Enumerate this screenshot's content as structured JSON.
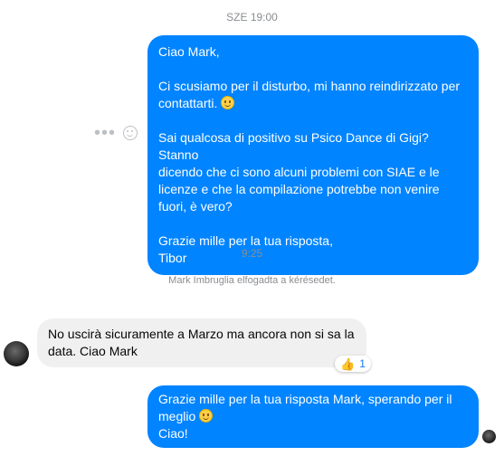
{
  "timestamps": {
    "first": "SZE 19:00",
    "second": "9:25"
  },
  "system_message": "Mark Imbruglia elfogadta a kérésedet.",
  "message1": {
    "greeting": "Ciao Mark,",
    "line1a": "Ci scusiamo per il disturbo, mi hanno reindirizzato per",
    "line1b": "contattarti.",
    "line2a": "Sai qualcosa di positivo su Psico Dance di Gigi? Stanno",
    "line2b": "dicendo che ci sono alcuni problemi con SIAE e le",
    "line2c": "licenze e che la compilazione potrebbe non venire",
    "line2d": "fuori, è vero?",
    "line3a": "Grazie mille per la tua risposta,",
    "line3b": "Tibor"
  },
  "message2": {
    "line1": "No uscirà sicuramente a Marzo ma ancora non si sa la",
    "line2": "data. Ciao Mark",
    "reaction_icon": "thumbs-up",
    "reaction_count": "1"
  },
  "message3": {
    "line1": "Grazie mille per la tua risposta Mark, sperando per il",
    "line2": "meglio",
    "line3": "Ciao!"
  },
  "icons": {
    "more": "more-dots-icon",
    "react": "smiley-react-icon",
    "emoji1": "slightly-smiling-face",
    "emoji2": "smiling-face-with-smiling-eyes"
  },
  "colors": {
    "outgoing": "#0084ff",
    "incoming": "#f0f0f0",
    "meta": "#8a8d91",
    "reaction": "#1877f2"
  }
}
